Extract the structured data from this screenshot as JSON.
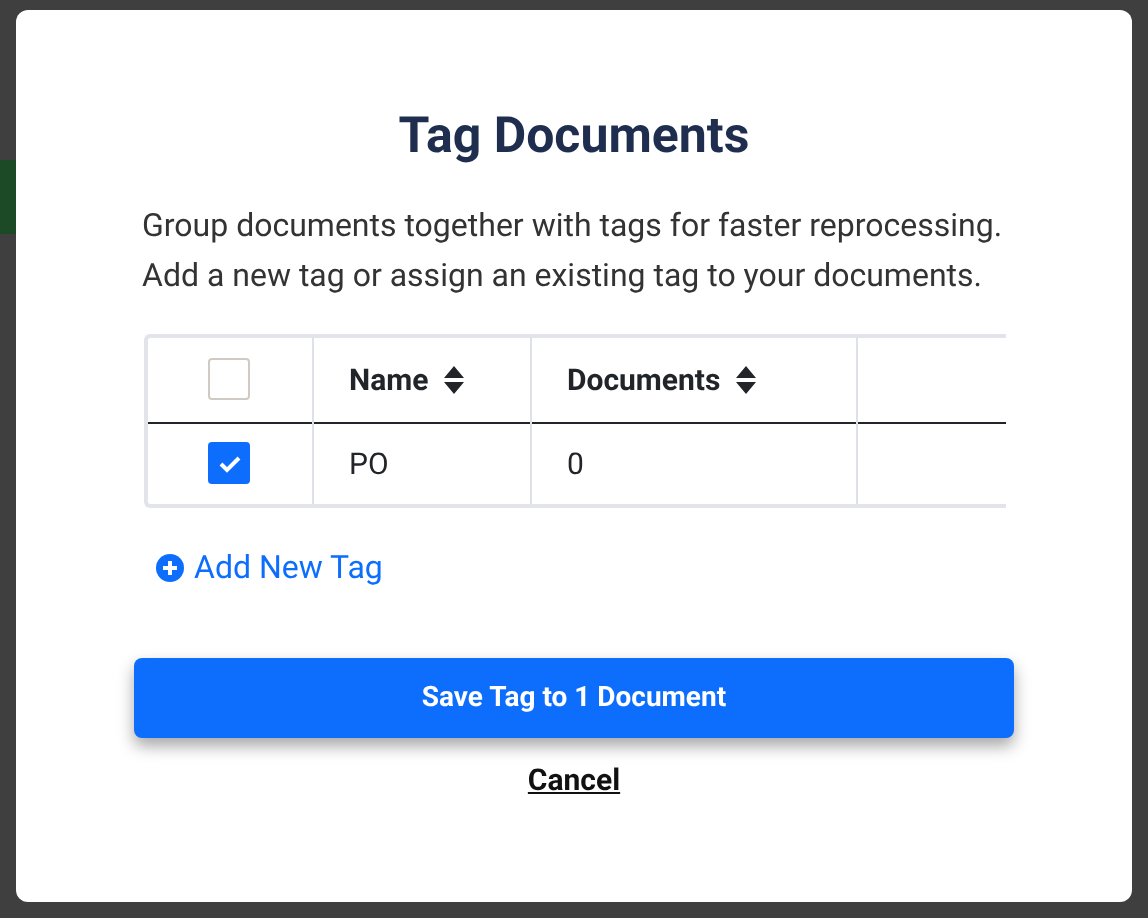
{
  "dialog": {
    "title": "Tag Documents",
    "description": [
      "Group documents together with tags for faster reprocessing.",
      "Add a new tag or assign an existing tag to your documents."
    ],
    "table": {
      "select_all": {
        "checked": false
      },
      "columns": [
        "Name",
        "Documents"
      ],
      "rows": [
        {
          "checked": true,
          "cells": [
            "PO",
            "0"
          ]
        }
      ]
    },
    "add_link": "Add New Tag",
    "primary_button": "Save Tag to 1 Document",
    "cancel_link": "Cancel"
  }
}
